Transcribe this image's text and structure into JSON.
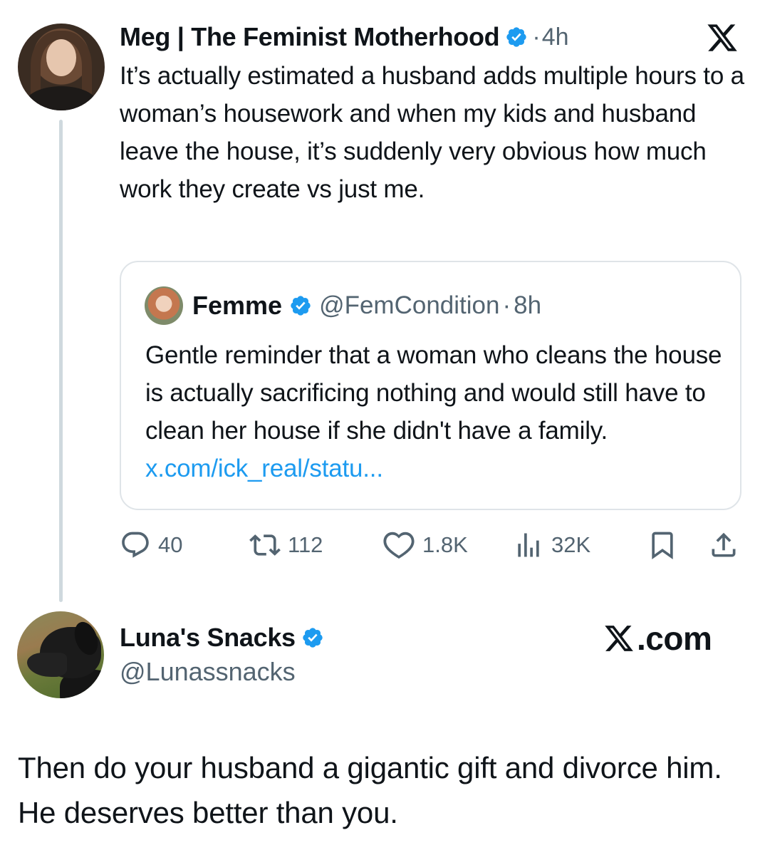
{
  "main_tweet": {
    "author_name": "Meg | The Feminist Motherhood",
    "separator": "·",
    "time": "4h",
    "text": "It’s actually estimated a husband adds multiple hours to a woman’s housework and when my kids and husband leave the house, it’s suddenly very obvious how much work they create vs just me.",
    "quoted": {
      "author_name": "Femme",
      "handle": "@FemCondition",
      "separator": "·",
      "time": "8h",
      "text": "Gentle reminder that a woman who cleans the house is actually sacrificing nothing and would still have to clean her house if she didn't have a family.",
      "link": "x.com/ick_real/statu..."
    },
    "actions": {
      "replies": "40",
      "reposts": "112",
      "likes": "1.8K",
      "views": "32K"
    }
  },
  "reply": {
    "author_name": "Luna's Snacks",
    "handle": "@Lunassnacks",
    "text": "Then do your husband a gigantic gift and divorce him. He deserves better than you."
  },
  "watermark": {
    "suffix": ".com"
  },
  "icons": {
    "verified": "verified-badge-icon",
    "logo": "x-logo-icon",
    "reply": "reply-icon",
    "repost": "repost-icon",
    "like": "like-icon",
    "views": "views-icon",
    "bookmark": "bookmark-icon",
    "share": "share-icon"
  },
  "colors": {
    "text": "#0f1419",
    "secondary": "#536471",
    "link": "#1d9bf0",
    "verified": "#1d9bf0",
    "border": "#dfe4e8",
    "thread_line": "#cfd9de"
  }
}
